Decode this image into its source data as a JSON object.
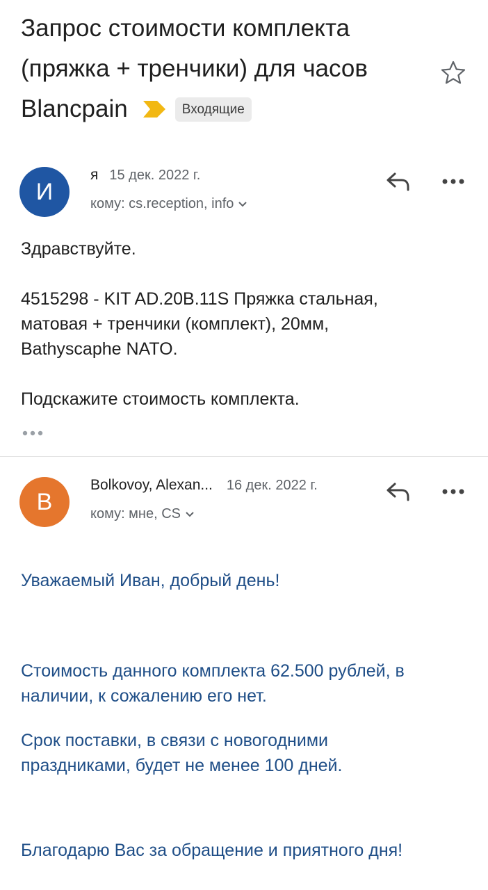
{
  "thread": {
    "subject_line1": "Запрос стоимости комплекта",
    "subject_line2": "(пряжка + тренчики) для часов",
    "subject_line3": "Blancpain",
    "label": "Входящие",
    "importance_color": "#f2b813"
  },
  "messages": [
    {
      "avatar_letter": "И",
      "avatar_color": "#1f56a3",
      "sender": "я",
      "date": "15 дек. 2022 г.",
      "recipients": "кому: cs.reception, info",
      "body": {
        "greeting": "Здравствуйте.",
        "item_line1": "4515298 - KIT AD.20B.11S Пряжка стальная,",
        "item_line2": "матовая + тренчики (комплект), 20мм,",
        "item_line3": "Bathyscaphe NATO.",
        "question": "Подскажите стоимость комплекта."
      }
    },
    {
      "avatar_letter": "B",
      "avatar_color": "#e5762d",
      "sender": "Bolkovoy, Alexan...",
      "date": "16 дек. 2022 г.",
      "recipients": "кому: мне, CS",
      "body": {
        "greeting": "Уважаемый Иван, добрый день!",
        "price_line1": "Стоимость данного комплекта 62.500 рублей, в",
        "price_line2": "наличии, к сожалению его нет.",
        "delivery_line1": "Срок поставки, в связи с новогодними",
        "delivery_line2": "праздниками, будет не менее 100 дней.",
        "closing": "Благодарю Вас за обращение и приятного дня!"
      }
    }
  ]
}
